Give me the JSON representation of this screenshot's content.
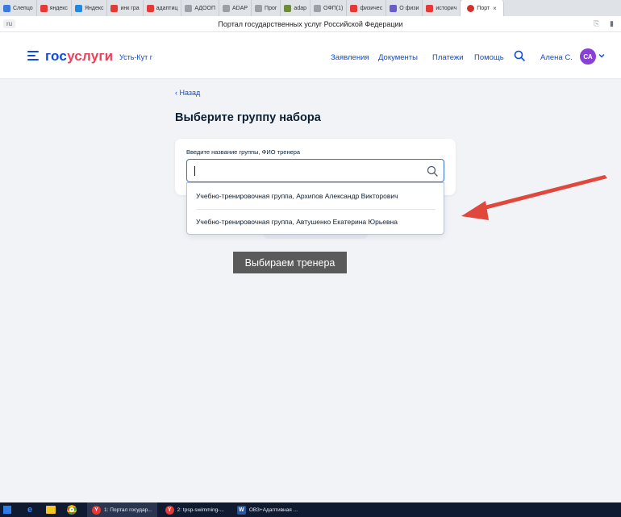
{
  "browser": {
    "tabs": [
      {
        "label": "Слепцо",
        "color": "#3b7be0"
      },
      {
        "label": "яндекс",
        "color": "#e53935"
      },
      {
        "label": "Яндекс",
        "color": "#1e88e5"
      },
      {
        "label": "инк гра",
        "color": "#e53935"
      },
      {
        "label": "адаптиц",
        "color": "#e53935"
      },
      {
        "label": "АДООП",
        "color": "#9aa0a6"
      },
      {
        "label": "ADAP",
        "color": "#9aa0a6"
      },
      {
        "label": "Прог",
        "color": "#9aa0a6"
      },
      {
        "label": "adap",
        "color": "#6d8b3a"
      },
      {
        "label": "ОФП(1)",
        "color": "#9aa0a6"
      },
      {
        "label": "физичес",
        "color": "#e53935"
      },
      {
        "label": "О физи",
        "color": "#6a5acd"
      },
      {
        "label": "историч",
        "color": "#e53935"
      }
    ],
    "active_tab": {
      "label": "Порт",
      "close": "×",
      "color": "#d32f2f"
    },
    "url_fragment": "ru",
    "page_title": "Портал государственных услуг Российской Федерации"
  },
  "header": {
    "logo_part1": "гос",
    "logo_part2": "услуги",
    "city": "Усть-Кут г",
    "nav": [
      "Заявления",
      "Документы",
      "Платежи",
      "Помощь"
    ],
    "user_name": "Алена С.",
    "avatar_initials": "СА",
    "brand_blue": "#0d4cd3",
    "brand_red": "#ee3f58",
    "avatar_color": "#8b3fd9"
  },
  "main": {
    "back_label": "Назад",
    "heading": "Выберите группу набора",
    "search_label": "Введите название группы, ФИО тренера",
    "search_value": "",
    "options": [
      "Учебно-тренировочная группа, Архипов Александр Викторович",
      "Учебно-тренировочная группа, Автушенко Екатерина Юрьевна"
    ]
  },
  "annotation": {
    "tooltip_text": "Выбираем тренера",
    "arrow_color": "#e0483c"
  },
  "taskbar": {
    "apps": [
      {
        "label": "1: Портал государ...",
        "icon": "yandex-browser-icon",
        "active": true
      },
      {
        "label": "2: tpsp-swimming-...",
        "icon": "yandex-browser-icon",
        "active": false
      },
      {
        "label": "ОВЗ+Адаптивная ...",
        "icon": "word-icon",
        "active": false
      }
    ]
  }
}
